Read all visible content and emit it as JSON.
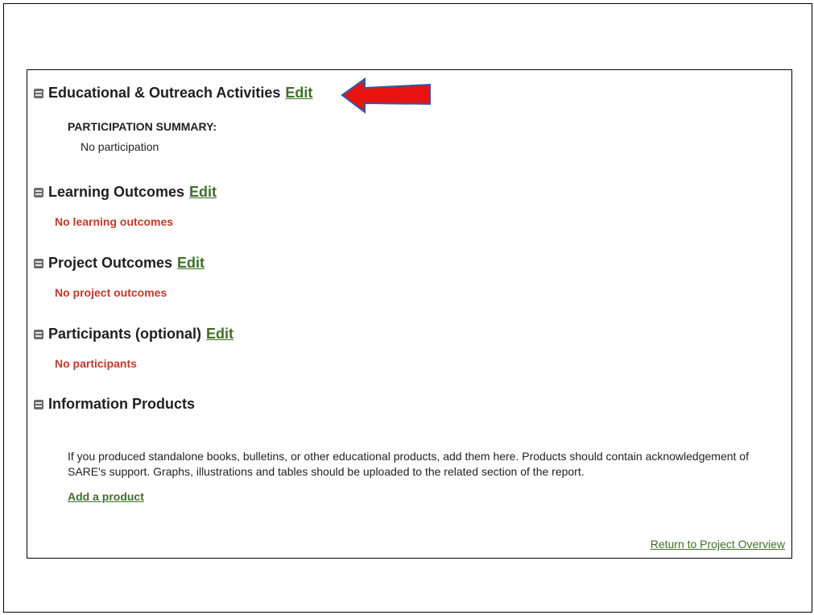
{
  "sections": [
    {
      "title": "Educational & Outreach Activities",
      "edit_label": "Edit",
      "participation": {
        "label": "PARTICIPATION SUMMARY:",
        "value": "No participation"
      }
    },
    {
      "title": "Learning Outcomes",
      "edit_label": "Edit",
      "empty_message": "No learning outcomes"
    },
    {
      "title": "Project Outcomes",
      "edit_label": "Edit",
      "empty_message": "No project outcomes"
    },
    {
      "title": "Participants (optional)",
      "edit_label": "Edit",
      "empty_message": "No participants"
    },
    {
      "title": "Information Products",
      "description": "If you produced standalone books, bulletins, or other educational products, add them here. Products should contain acknowledgement of SARE's support. Graphs, illustrations and tables should be uploaded to the related section of the report.",
      "add_link": "Add a product"
    }
  ],
  "footer": {
    "return_link": "Return to Project Overview"
  },
  "annotation": {
    "arrow_color": "#e8130f",
    "arrow_outline": "#2e5aa6"
  },
  "colors": {
    "link_green": "#3f6f2a",
    "empty_red": "#c0392b"
  }
}
